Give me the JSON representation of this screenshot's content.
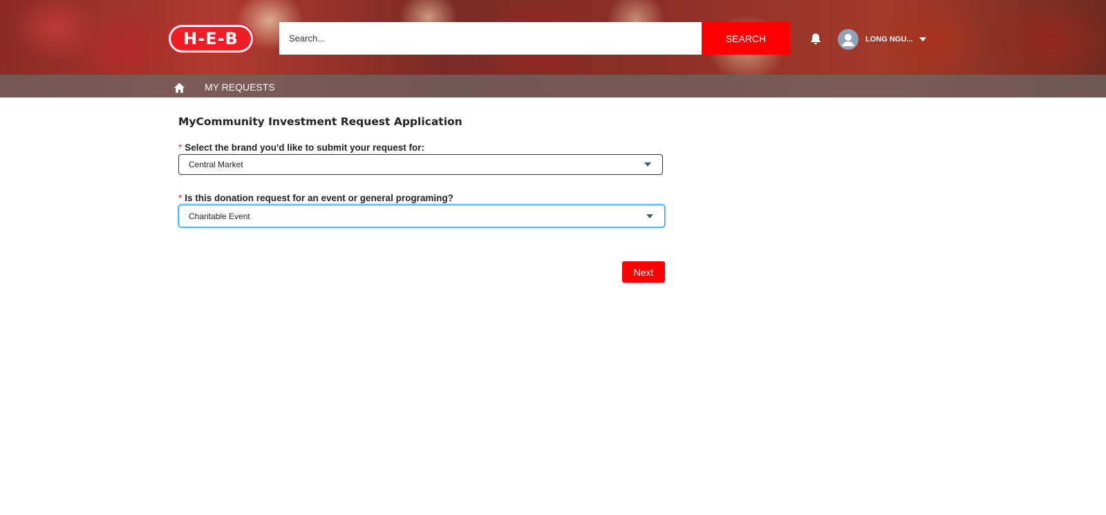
{
  "brand": {
    "logo_text": "H-E-B"
  },
  "search": {
    "placeholder": "Search...",
    "button_label": "SEARCH"
  },
  "user": {
    "name": "LONG NGU..."
  },
  "nav": {
    "items": [
      {
        "label": "MY REQUESTS"
      }
    ]
  },
  "form": {
    "title": "MyCommunity Investment Request Application",
    "fields": [
      {
        "required_mark": "*",
        "label": "Select the brand you'd like to submit your request for:",
        "value": "Central Market"
      },
      {
        "required_mark": "*",
        "label": "Is this donation request for an event or general programing?",
        "value": "Charitable Event"
      }
    ],
    "next_label": "Next"
  },
  "colors": {
    "accent": "#ff0000",
    "focus": "#1b96ff"
  },
  "icons": [
    "home-icon",
    "bell-icon",
    "user-avatar-icon",
    "chevron-down-icon"
  ]
}
